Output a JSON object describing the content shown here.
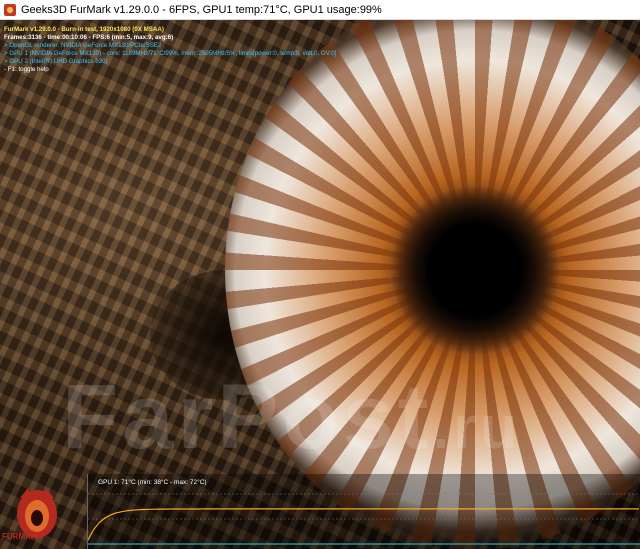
{
  "window": {
    "title": "Geeks3D FurMark v1.29.0.0 - 6FPS, GPU1 temp:71°C, GPU1 usage:99%"
  },
  "hud": {
    "line1": "FurMark v1.29.0.0 - Burn-in test, 1920x1080 (0X MSAA)",
    "line2": "Frames:3136 - time:00:10:06 - FPS:6 (min:5, max:9, avg:6)",
    "line3": "> OpenGL renderer: NVIDIA GeForce MX130/PCIe/SSE2",
    "line4": "> GPU 1 (NVIDIA GeForce MX130) - core: 1189MHz/71°C/99%, mem: 2505MHz/5%, limits[power:0, temp:0, volt:0, OV:0]",
    "line5": "> GPU 2 (Intel(R) UHD Graphics 620)",
    "line6": "- F1: toggle help"
  },
  "graph": {
    "label": "GPU 1: 71°C (min: 38°C - max: 72°C)",
    "min_temp": 38,
    "max_temp": 72,
    "current_temp": 71,
    "line_color": "#f5a623",
    "baseline_color": "#2aa8c8"
  },
  "watermark": {
    "text": "FarPost",
    "suffix": ".ru"
  },
  "logo": {
    "text": "FURMARK"
  }
}
